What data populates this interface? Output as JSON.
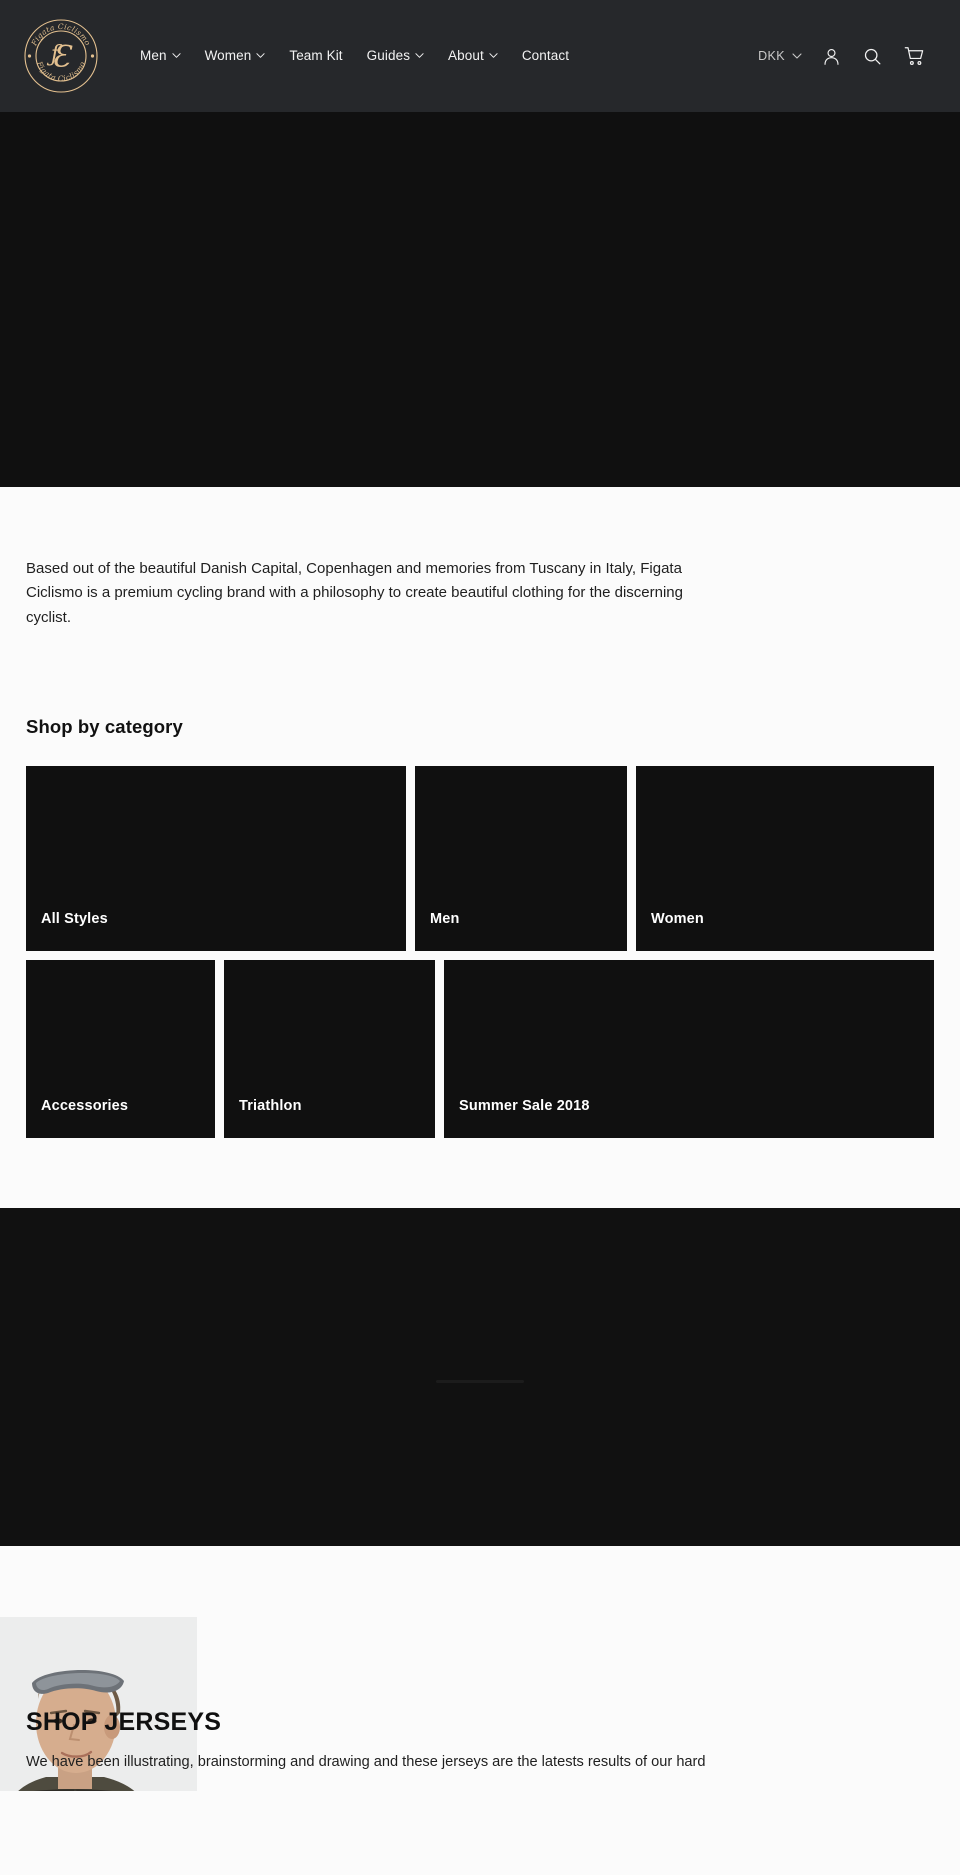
{
  "header": {
    "logo": {
      "name": "figata-ciclismo-logo",
      "top_text": "Figata Ciclismo",
      "bottom_text": "Figata Ciclismo",
      "monogram": "FC",
      "color": "#e3c08f"
    },
    "nav": [
      {
        "label": "Men",
        "has_dropdown": true,
        "icon": "chevron-down-icon"
      },
      {
        "label": "Women",
        "has_dropdown": true,
        "icon": "chevron-down-icon"
      },
      {
        "label": "Team Kit",
        "has_dropdown": false,
        "icon": ""
      },
      {
        "label": "Guides",
        "has_dropdown": true,
        "icon": "chevron-down-icon"
      },
      {
        "label": "About",
        "has_dropdown": true,
        "icon": "chevron-down-icon"
      },
      {
        "label": "Contact",
        "has_dropdown": false,
        "icon": ""
      }
    ],
    "currency": {
      "value": "DKK",
      "icon": "chevron-down-icon"
    },
    "account_icon": "account-icon",
    "search_icon": "search-icon",
    "cart_icon": "cart-icon",
    "background": "#26282b"
  },
  "hero": {
    "background": "#101010"
  },
  "intro": {
    "paragraph": "Based out of the beautiful Danish Capital, Copenhagen and memories from Tuscany in Italy, Figata Ciclismo is a premium cycling brand with a philosophy to create beautiful clothing for the discerning cyclist."
  },
  "categories": {
    "title": "Shop by category",
    "rows": [
      [
        {
          "label": "All Styles"
        },
        {
          "label": "Men"
        },
        {
          "label": "Women"
        }
      ],
      [
        {
          "label": "Accessories"
        },
        {
          "label": "Triathlon"
        },
        {
          "label": "Summer Sale 2018"
        }
      ]
    ]
  },
  "dark_band": {
    "background": "#111111"
  },
  "feature": {
    "title": "SHOP JERSEYS",
    "body": "We have been illustrating, brainstorming and drawing and these jerseys are the latests results of our hard",
    "photo_alt": "cyclist-portrait"
  },
  "colors": {
    "header_bg": "#26282b",
    "hero_bg": "#101010",
    "page_bg": "#fbfbfb",
    "tile_bg": "#101010",
    "brand_gold": "#e3c08f",
    "text_light": "#f2f2f2",
    "text_dark": "#1f1f1f"
  }
}
